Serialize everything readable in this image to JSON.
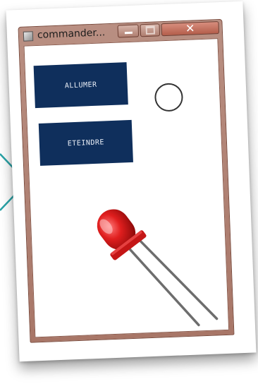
{
  "window": {
    "title": "commander...",
    "close_glyph": "✕"
  },
  "buttons": {
    "on_label": "ALLUMER",
    "off_label": "ETEINDRE"
  },
  "indicator": {
    "state": "off",
    "color": "#ffffff"
  },
  "led": {
    "icon": "red-led-icon",
    "color": "#e01e1e"
  },
  "decoration": {
    "arrow_color": "#2aa3a7"
  }
}
